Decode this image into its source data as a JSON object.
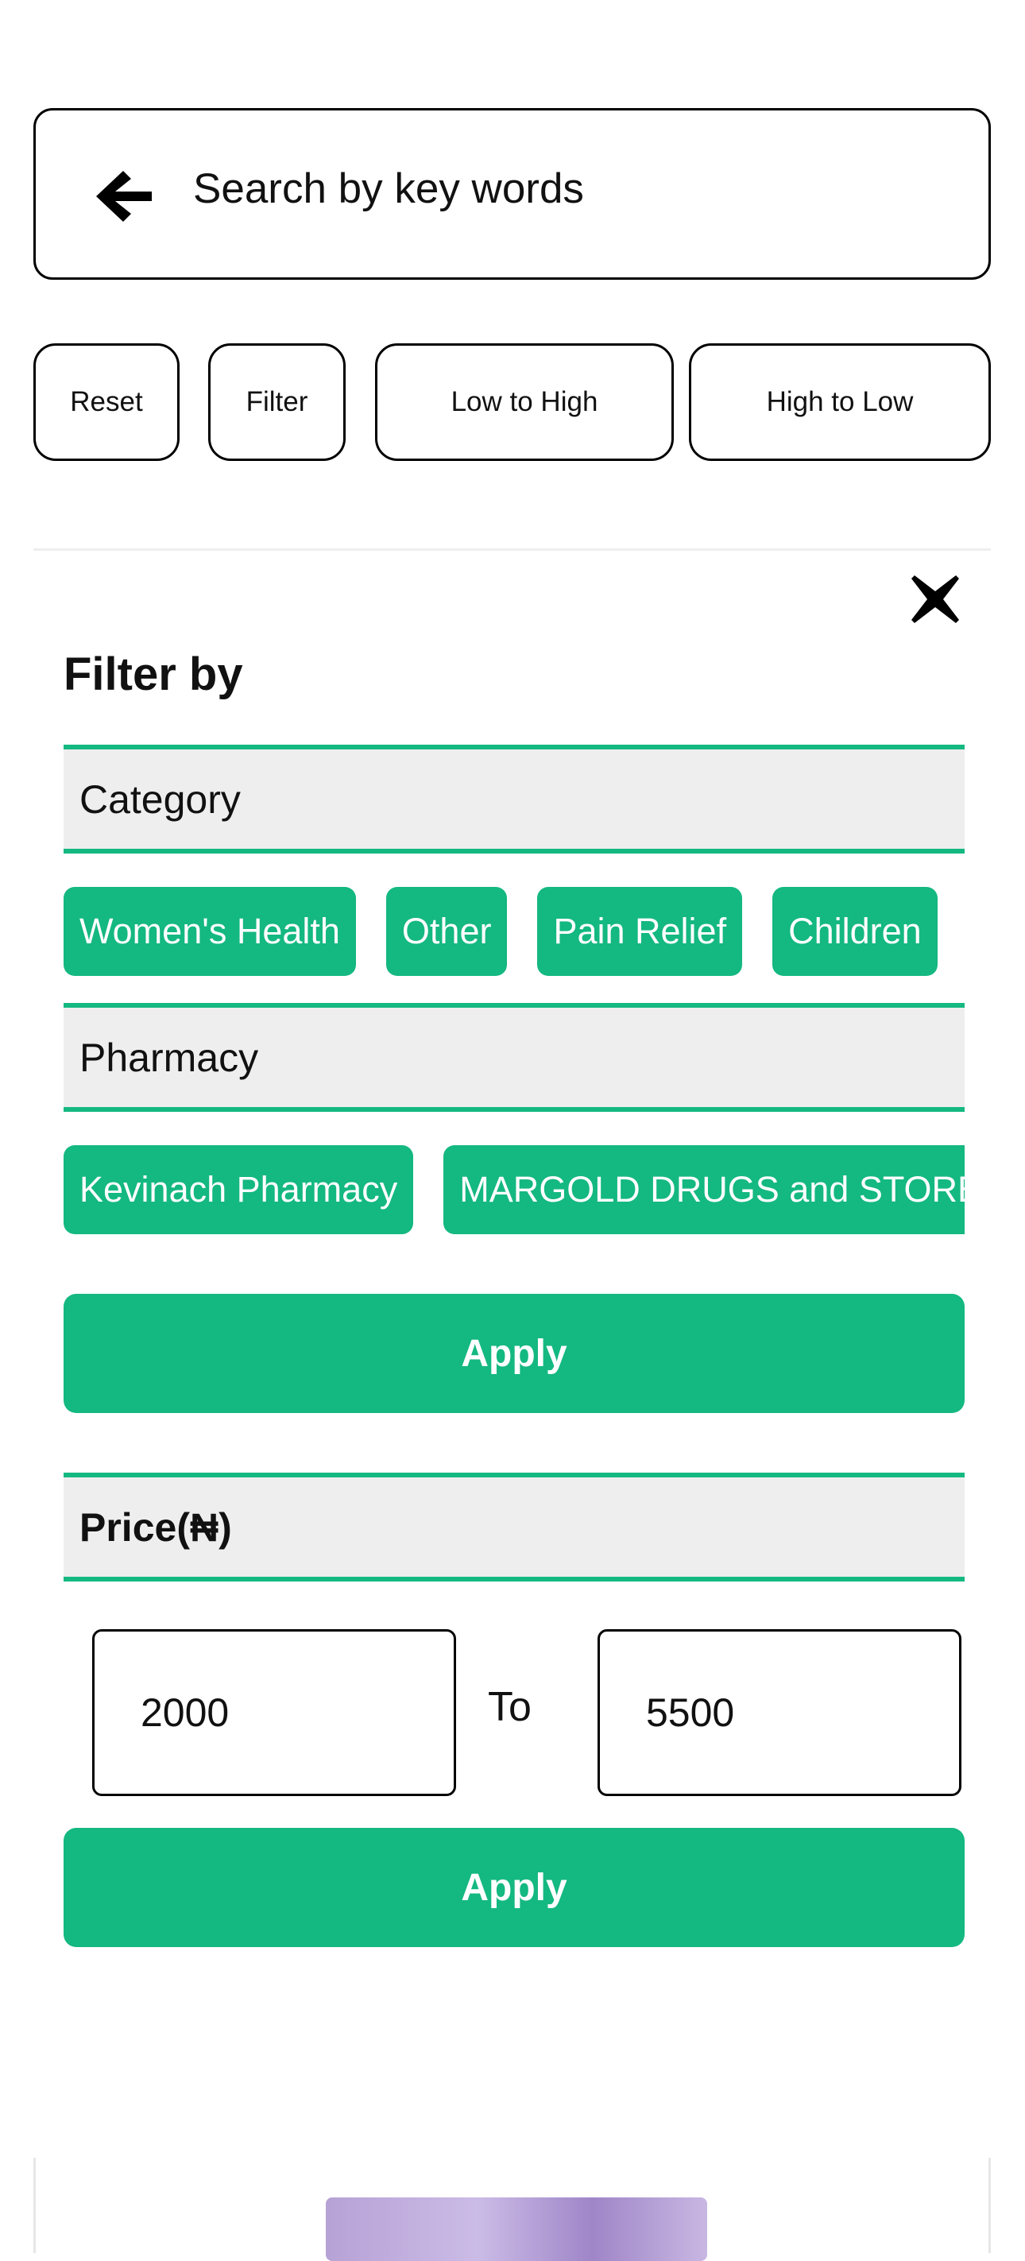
{
  "search": {
    "placeholder": "Search by key words"
  },
  "toolbar": {
    "reset_label": "Reset",
    "filter_label": "Filter",
    "low_to_high_label": "Low to High",
    "high_to_low_label": "High to Low"
  },
  "filter_panel": {
    "title": "Filter by",
    "category": {
      "header": "Category",
      "chips": [
        "Women's Health",
        "Other",
        "Pain Relief",
        "Children"
      ]
    },
    "pharmacy": {
      "header": "Pharmacy",
      "chips": [
        "Kevinach Pharmacy",
        "MARGOLD DRUGS and STORES"
      ]
    },
    "apply_label": "Apply",
    "price": {
      "header": "Price(₦)",
      "min_value": "2000",
      "to_label": "To",
      "max_value": "5500",
      "apply_label": "Apply"
    }
  },
  "colors": {
    "accent": "#14b881",
    "section_bg": "#eeeeee"
  },
  "icons": {
    "back": "arrow-left-icon",
    "close": "close-icon"
  }
}
